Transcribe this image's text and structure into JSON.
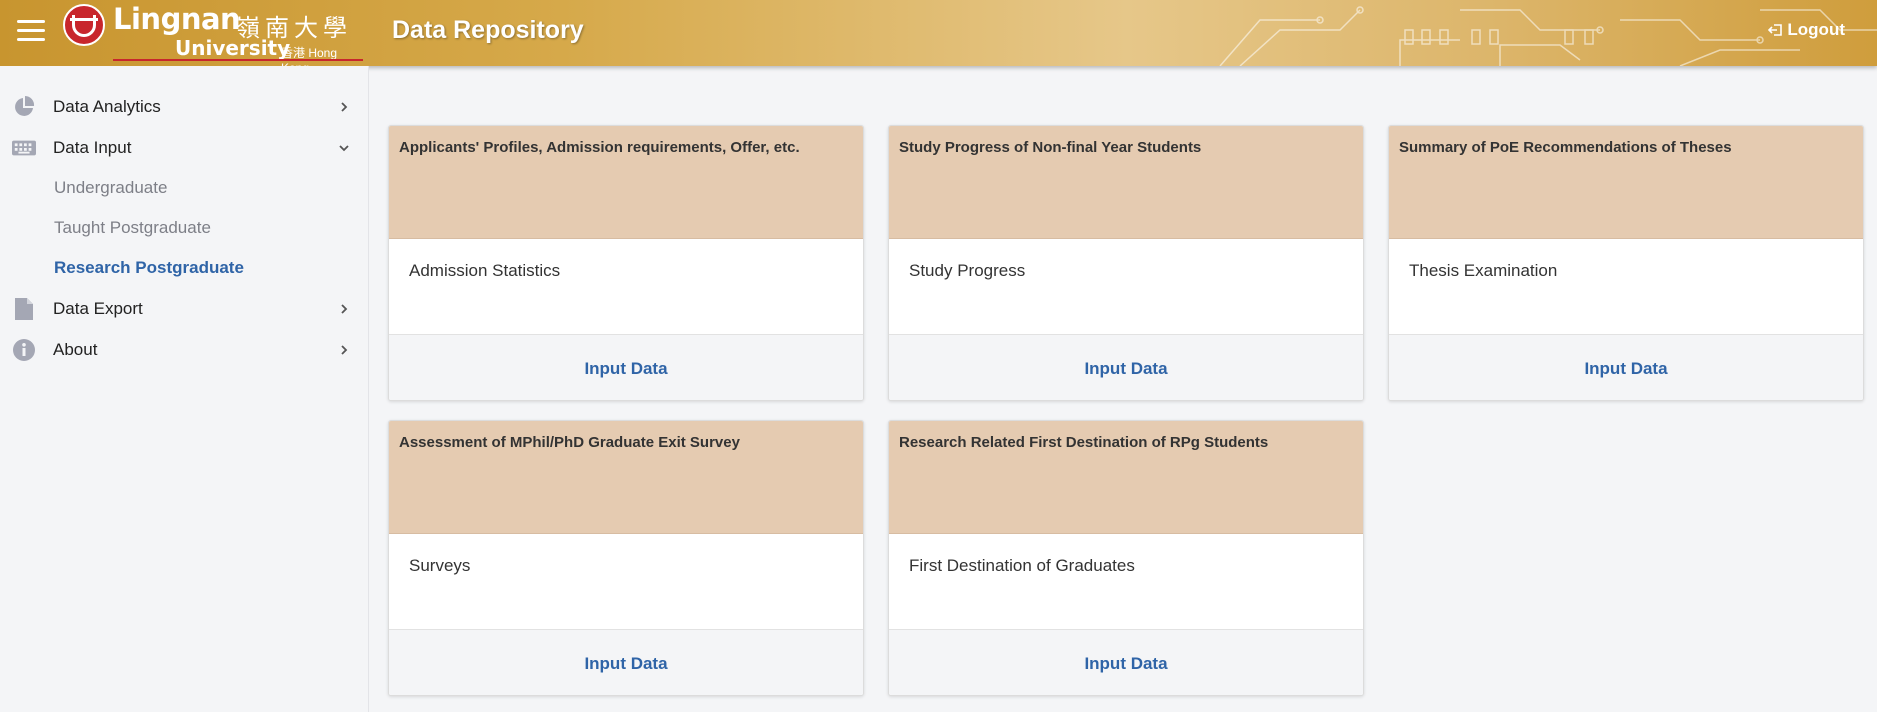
{
  "header": {
    "logo_en": "Lingnan",
    "logo_zh": "嶺南大學",
    "logo_sub": "University",
    "logo_sub2": "香港 Hong Kong",
    "title": "Data Repository",
    "logout_label": "Logout"
  },
  "sidebar": {
    "items": [
      {
        "label": "Data Analytics",
        "icon": "pie-chart-icon"
      },
      {
        "label": "Data Input",
        "icon": "keyboard-icon"
      },
      {
        "label": "Data Export",
        "icon": "file-icon"
      },
      {
        "label": "About",
        "icon": "info-icon"
      }
    ],
    "sub_items": [
      "Undergraduate",
      "Taught Postgraduate",
      "Research Postgraduate"
    ],
    "active": "Research Postgraduate"
  },
  "cards": [
    {
      "title": "Applicants' Profiles, Admission requirements, Offer, etc.",
      "body": "Admission Statistics",
      "button": "Input Data"
    },
    {
      "title": "Study Progress of Non-final Year Students",
      "body": "Study Progress",
      "button": "Input Data"
    },
    {
      "title": "Summary of PoE Recommendations of Theses",
      "body": "Thesis Examination",
      "button": "Input Data"
    },
    {
      "title": "Assessment of MPhil/PhD Graduate Exit Survey",
      "body": "Surveys",
      "button": "Input Data"
    },
    {
      "title": "Research Related First Destination of RPg Students",
      "body": "First Destination of Graduates",
      "button": "Input Data"
    }
  ],
  "colors": {
    "header_gold": "#d6a94a",
    "card_header": "#e5cbb1",
    "link_blue": "#2f64a7",
    "brand_red": "#c8262c"
  }
}
